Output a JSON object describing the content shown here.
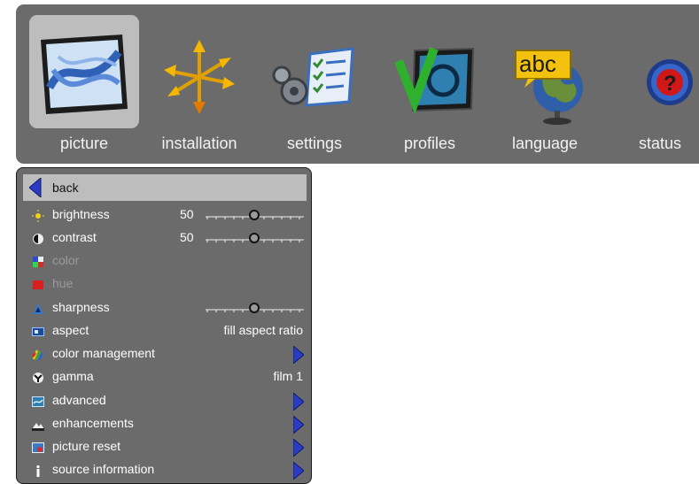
{
  "tabs": [
    {
      "label": "picture",
      "icon": "picture-icon",
      "active": true
    },
    {
      "label": "installation",
      "icon": "installation-icon"
    },
    {
      "label": "settings",
      "icon": "settings-icon"
    },
    {
      "label": "profiles",
      "icon": "profiles-icon"
    },
    {
      "label": "language",
      "icon": "language-icon"
    },
    {
      "label": "status",
      "icon": "status-icon"
    }
  ],
  "menu": {
    "back": "back",
    "items": [
      {
        "label": "brightness",
        "value": "50",
        "icon": "sun-icon",
        "slider_fraction": 0.5
      },
      {
        "label": "contrast",
        "value": "50",
        "icon": "contrast-icon",
        "slider_fraction": 0.5
      },
      {
        "label": "color",
        "icon": "color-icon",
        "disabled": true
      },
      {
        "label": "hue",
        "icon": "hue-icon",
        "disabled": true
      },
      {
        "label": "sharpness",
        "icon": "sharpness-icon",
        "slider_fraction": 0.5
      },
      {
        "label": "aspect",
        "value": "fill aspect ratio",
        "icon": "aspect-icon"
      },
      {
        "label": "color management",
        "icon": "color-management-icon",
        "submenu": true
      },
      {
        "label": "gamma",
        "value": "film 1",
        "icon": "gamma-icon"
      },
      {
        "label": "advanced",
        "icon": "advanced-icon",
        "submenu": true
      },
      {
        "label": "enhancements",
        "icon": "enhancements-icon",
        "submenu": true
      },
      {
        "label": "picture reset",
        "icon": "picture-reset-icon",
        "submenu": true
      },
      {
        "label": "source information",
        "icon": "info-icon",
        "submenu": true
      }
    ]
  },
  "colors": {
    "panel": "#6b6b6b",
    "selected": "#bdbdbd",
    "arrow": "#2b3cc4"
  }
}
